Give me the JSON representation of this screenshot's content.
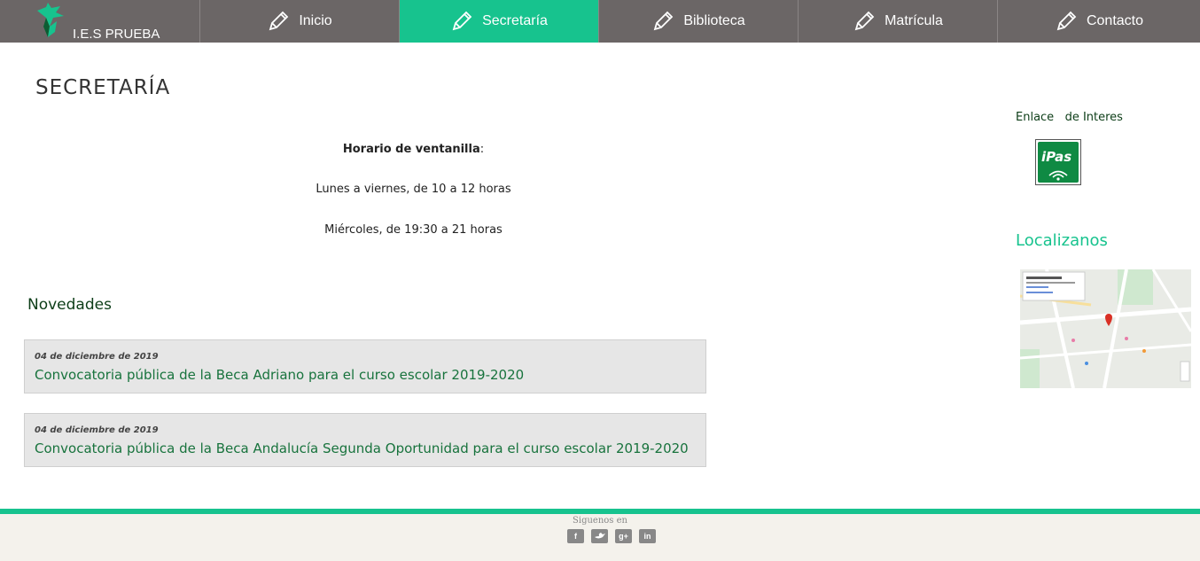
{
  "brand": {
    "name": "I.E.S PRUEBA"
  },
  "nav": {
    "items": [
      {
        "label": "Inicio",
        "icon": "pencil-icon",
        "active": false
      },
      {
        "label": "Secretaría",
        "icon": "pencil-icon",
        "active": true
      },
      {
        "label": "Biblioteca",
        "icon": "pencil-icon",
        "active": false
      },
      {
        "label": "Matrícula",
        "icon": "pencil-icon",
        "active": false
      },
      {
        "label": "Contacto",
        "icon": "pencil-icon",
        "active": false
      }
    ]
  },
  "page": {
    "title": "SECRETARÍA",
    "schedule_label": "Horario de ventanilla",
    "schedule_colon": ":",
    "schedule_line1": "Lunes a viernes, de 10 a 12 horas",
    "schedule_line2": "Miércoles, de 19:30 a 21 horas"
  },
  "news": {
    "heading": "Novedades",
    "items": [
      {
        "date": "04 de diciembre de 2019",
        "title": "Convocatoria pública de la Beca Adriano para el curso escolar 2019-2020"
      },
      {
        "date": "04 de diciembre de 2019",
        "title": "Convocatoria pública de la Beca Andalucía Segunda Oportunidad para el curso escolar 2019-2020"
      }
    ]
  },
  "sidebar": {
    "links_label": "Enlace   de Interes",
    "ipas_label": "iPas",
    "map_heading": "Localizanos"
  },
  "footer": {
    "follow_label": "Siguenos en",
    "social_icons": [
      "facebook-icon",
      "twitter-icon",
      "google-plus-icon",
      "linkedin-icon"
    ]
  },
  "colors": {
    "nav_bg": "#6b6666",
    "accent": "#17c38e",
    "link_green": "#18733d",
    "dark_green": "#0c3d17"
  }
}
